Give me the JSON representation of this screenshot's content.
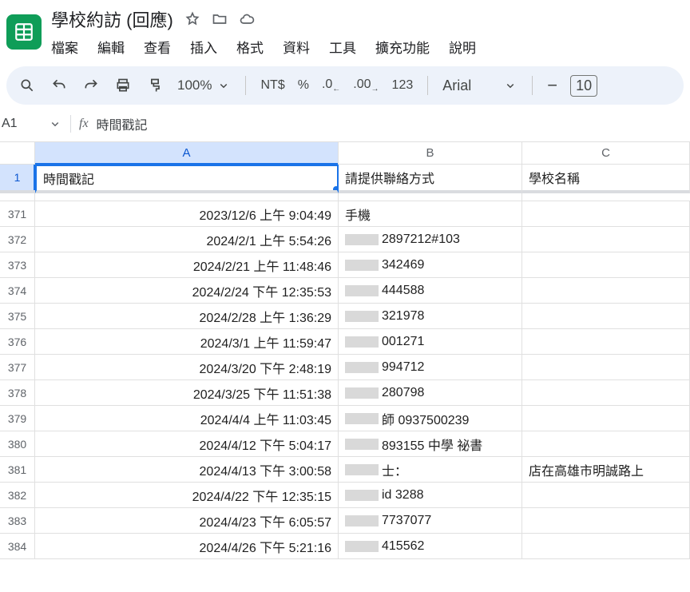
{
  "doc": {
    "title": "學校約訪 (回應)"
  },
  "menus": [
    "檔案",
    "編輯",
    "查看",
    "插入",
    "格式",
    "資料",
    "工具",
    "擴充功能",
    "說明"
  ],
  "toolbar": {
    "zoom": "100%",
    "currency": "NT$",
    "percent": "%",
    "dec_dec": ".0",
    "dec_inc": ".00",
    "num123": "123",
    "font": "Arial",
    "minus": "−",
    "fontsize": "10"
  },
  "namebox": {
    "ref": "A1",
    "fx": "fx",
    "formula": "時間戳記"
  },
  "columns": {
    "A": "A",
    "B": "B",
    "C": "C"
  },
  "header_row": {
    "num": "1",
    "A": "時間戳記",
    "B": "請提供聯絡方式",
    "C": "學校名稱"
  },
  "rows": [
    {
      "num": "371",
      "A": "2023/12/6 上午 9:04:49",
      "B": "手機",
      "C": ""
    },
    {
      "num": "372",
      "A": "2024/2/1 上午 5:54:26",
      "B": "2897212#103",
      "C": ""
    },
    {
      "num": "373",
      "A": "2024/2/21 上午 11:48:46",
      "B": "342469",
      "C": ""
    },
    {
      "num": "374",
      "A": "2024/2/24 下午 12:35:53",
      "B": "444588",
      "C": ""
    },
    {
      "num": "375",
      "A": "2024/2/28 上午 1:36:29",
      "B": "321978",
      "C": ""
    },
    {
      "num": "376",
      "A": "2024/3/1 上午 11:59:47",
      "B": "001271",
      "C": ""
    },
    {
      "num": "377",
      "A": "2024/3/20 下午 2:48:19",
      "B": "994712",
      "C": ""
    },
    {
      "num": "378",
      "A": "2024/3/25 下午 11:51:38",
      "B": "280798",
      "C": ""
    },
    {
      "num": "379",
      "A": "2024/4/4 上午 11:03:45",
      "B": "師 0937500239",
      "C": ""
    },
    {
      "num": "380",
      "A": "2024/4/12 下午 5:04:17",
      "B": "893155          中學 祕書",
      "C": ""
    },
    {
      "num": "381",
      "A": "2024/4/13 下午 3:00:58",
      "B": "士：",
      "C": "店在高雄市明誠路上"
    },
    {
      "num": "382",
      "A": "2024/4/22 下午 12:35:15",
      "B": "id          3288",
      "C": ""
    },
    {
      "num": "383",
      "A": "2024/4/23 下午 6:05:57",
      "B": "7737077",
      "C": ""
    },
    {
      "num": "384",
      "A": "2024/4/26 下午 5:21:16",
      "B": "415562",
      "C": ""
    }
  ]
}
